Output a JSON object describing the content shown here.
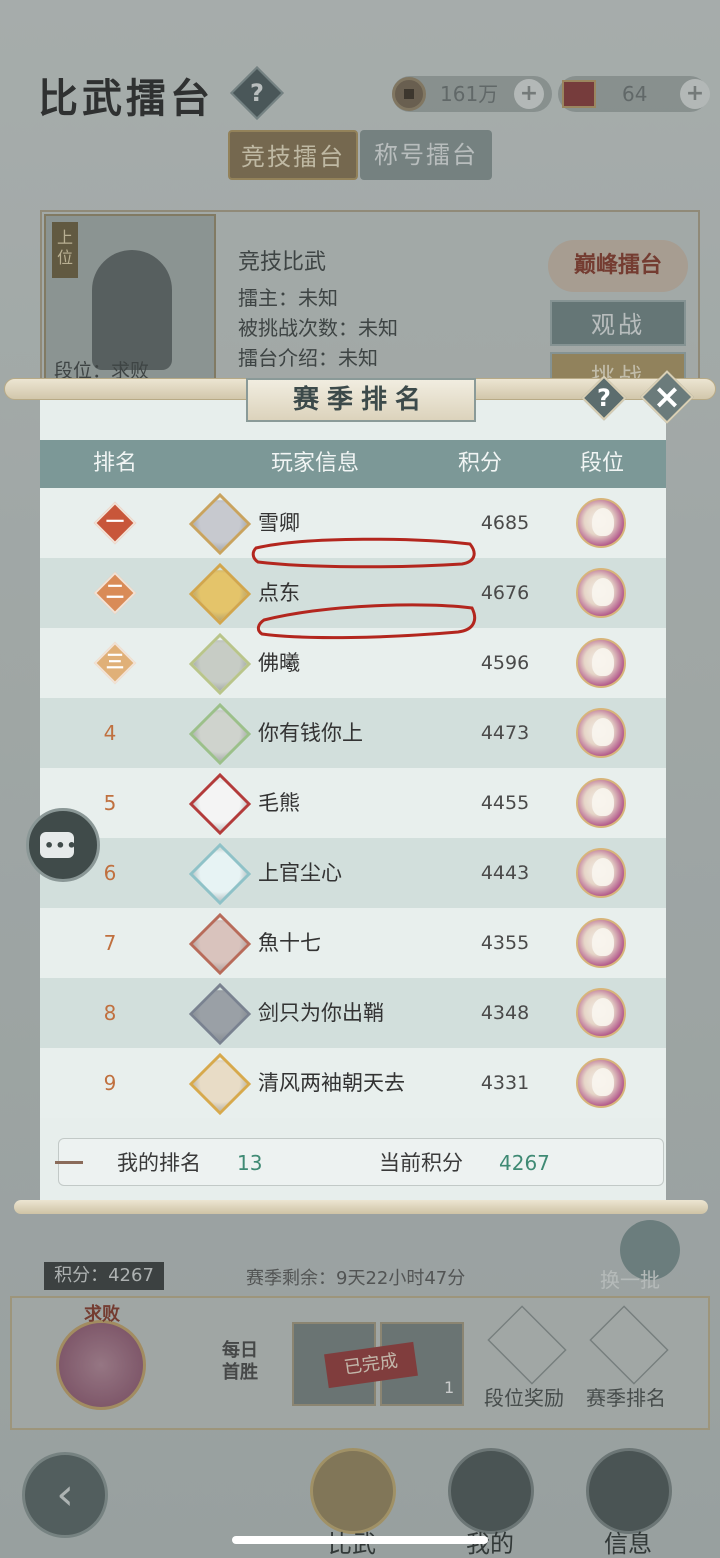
{
  "header": {
    "title": "比武擂台",
    "help_icon": "question-icon",
    "coins": {
      "icon": "coin-icon",
      "value": "161万"
    },
    "tickets": {
      "icon": "ticket-icon",
      "value": "64"
    }
  },
  "tabs": [
    {
      "label": "竞技擂台",
      "active": true
    },
    {
      "label": "称号擂台",
      "active": false
    }
  ],
  "arena": {
    "rank_tag": "上位",
    "tier_label": "段位：求败",
    "name": "竞技比武",
    "owner": "擂主：未知",
    "challenged": "被挑战次数：未知",
    "intro": "擂台介绍：未知",
    "peak_badge": "巅峰擂台",
    "watch_label": "观战",
    "challenge_label": "挑战"
  },
  "modal": {
    "title": "赛季排名",
    "columns": {
      "rank": "排名",
      "player": "玩家信息",
      "score": "积分",
      "tier": "段位"
    },
    "rows": [
      {
        "rank": "一",
        "medal": true,
        "name": "雪卿",
        "score": "4685"
      },
      {
        "rank": "二",
        "medal": true,
        "name": "点东",
        "score": "4676"
      },
      {
        "rank": "三",
        "medal": true,
        "name": "佛曦",
        "score": "4596"
      },
      {
        "rank": "4",
        "medal": false,
        "name": "你有钱你上",
        "score": "4473"
      },
      {
        "rank": "5",
        "medal": false,
        "name": "毛熊",
        "score": "4455"
      },
      {
        "rank": "6",
        "medal": false,
        "name": "上官尘心",
        "score": "4443"
      },
      {
        "rank": "7",
        "medal": false,
        "name": "魚十七",
        "score": "4355"
      },
      {
        "rank": "8",
        "medal": false,
        "name": "剑只为你出鞘",
        "score": "4348"
      },
      {
        "rank": "9",
        "medal": false,
        "name": "清风两袖朝天去",
        "score": "4331"
      }
    ],
    "my_rank_label": "我的排名",
    "my_rank_value": "13",
    "current_score_label": "当前积分",
    "current_score_value": "4267"
  },
  "footer": {
    "score_pill": "积分：4267",
    "season_remaining": "赛季剩余：9天22小时47分",
    "refresh_label": "换一批",
    "daily_first_win": "每日首胜",
    "completed_stamp": "已完成",
    "reward_count": "1",
    "tier_reward_label": "段位奖励",
    "season_rank_label": "赛季排名",
    "my_tier": "求败"
  },
  "nav": {
    "fight": "比武",
    "mine": "我的",
    "info": "信息"
  },
  "colors": {
    "header_row": "#7c9897",
    "row_odd": "#e8efed",
    "row_even": "#d2dfdc",
    "rank_orange": "#c0703f",
    "accent_green": "#3f8a74",
    "scribble_red": "#b3261e"
  }
}
